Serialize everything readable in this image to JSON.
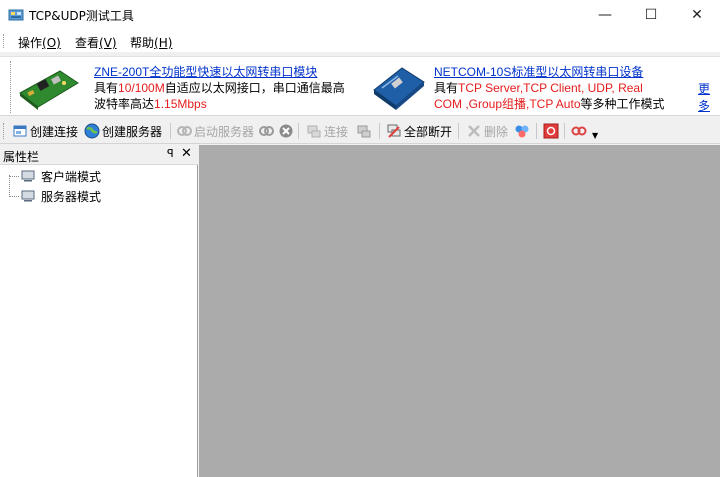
{
  "window": {
    "title": "TCP&UDP测试工具",
    "minimize": "—",
    "maximize": "☐",
    "close": "✕"
  },
  "menu": [
    {
      "label": "操作",
      "key": "(O)"
    },
    {
      "label": "查看",
      "key": "(V)"
    },
    {
      "label": "帮助",
      "key": "(H)"
    }
  ],
  "banner": {
    "product1": {
      "name": "ZNE-200T全功能型快速以太网转串口模块",
      "line2_pre": "具有",
      "line2_red": "10/100M",
      "line2_post": "自适应以太网接口，串口通信最高",
      "line3_pre": "波特率高达",
      "line3_red": "1.15Mbps"
    },
    "product2": {
      "name": "NETCOM-10S标准型以太网转串口设备",
      "line2_pre": "具有",
      "line2_red": "TCP Server,TCP Client, UDP, Real",
      "line3_red": "COM ,Group组播,TCP Auto",
      "line3_post": "等多种工作模式"
    },
    "more": "更多"
  },
  "toolbar": {
    "create_conn": "创建连接",
    "create_server": "创建服务器",
    "start_server": "启动服务器",
    "connect": "连接",
    "disconnect_all": "全部断开",
    "delete": "删除"
  },
  "panel": {
    "title": "属性栏",
    "pin": "ᵖ",
    "close": "✕",
    "items": [
      "客户端模式",
      "服务器模式"
    ]
  },
  "colors": {
    "link": "#0033cc",
    "highlight": "#e51c1c",
    "workspace": "#ababab"
  }
}
